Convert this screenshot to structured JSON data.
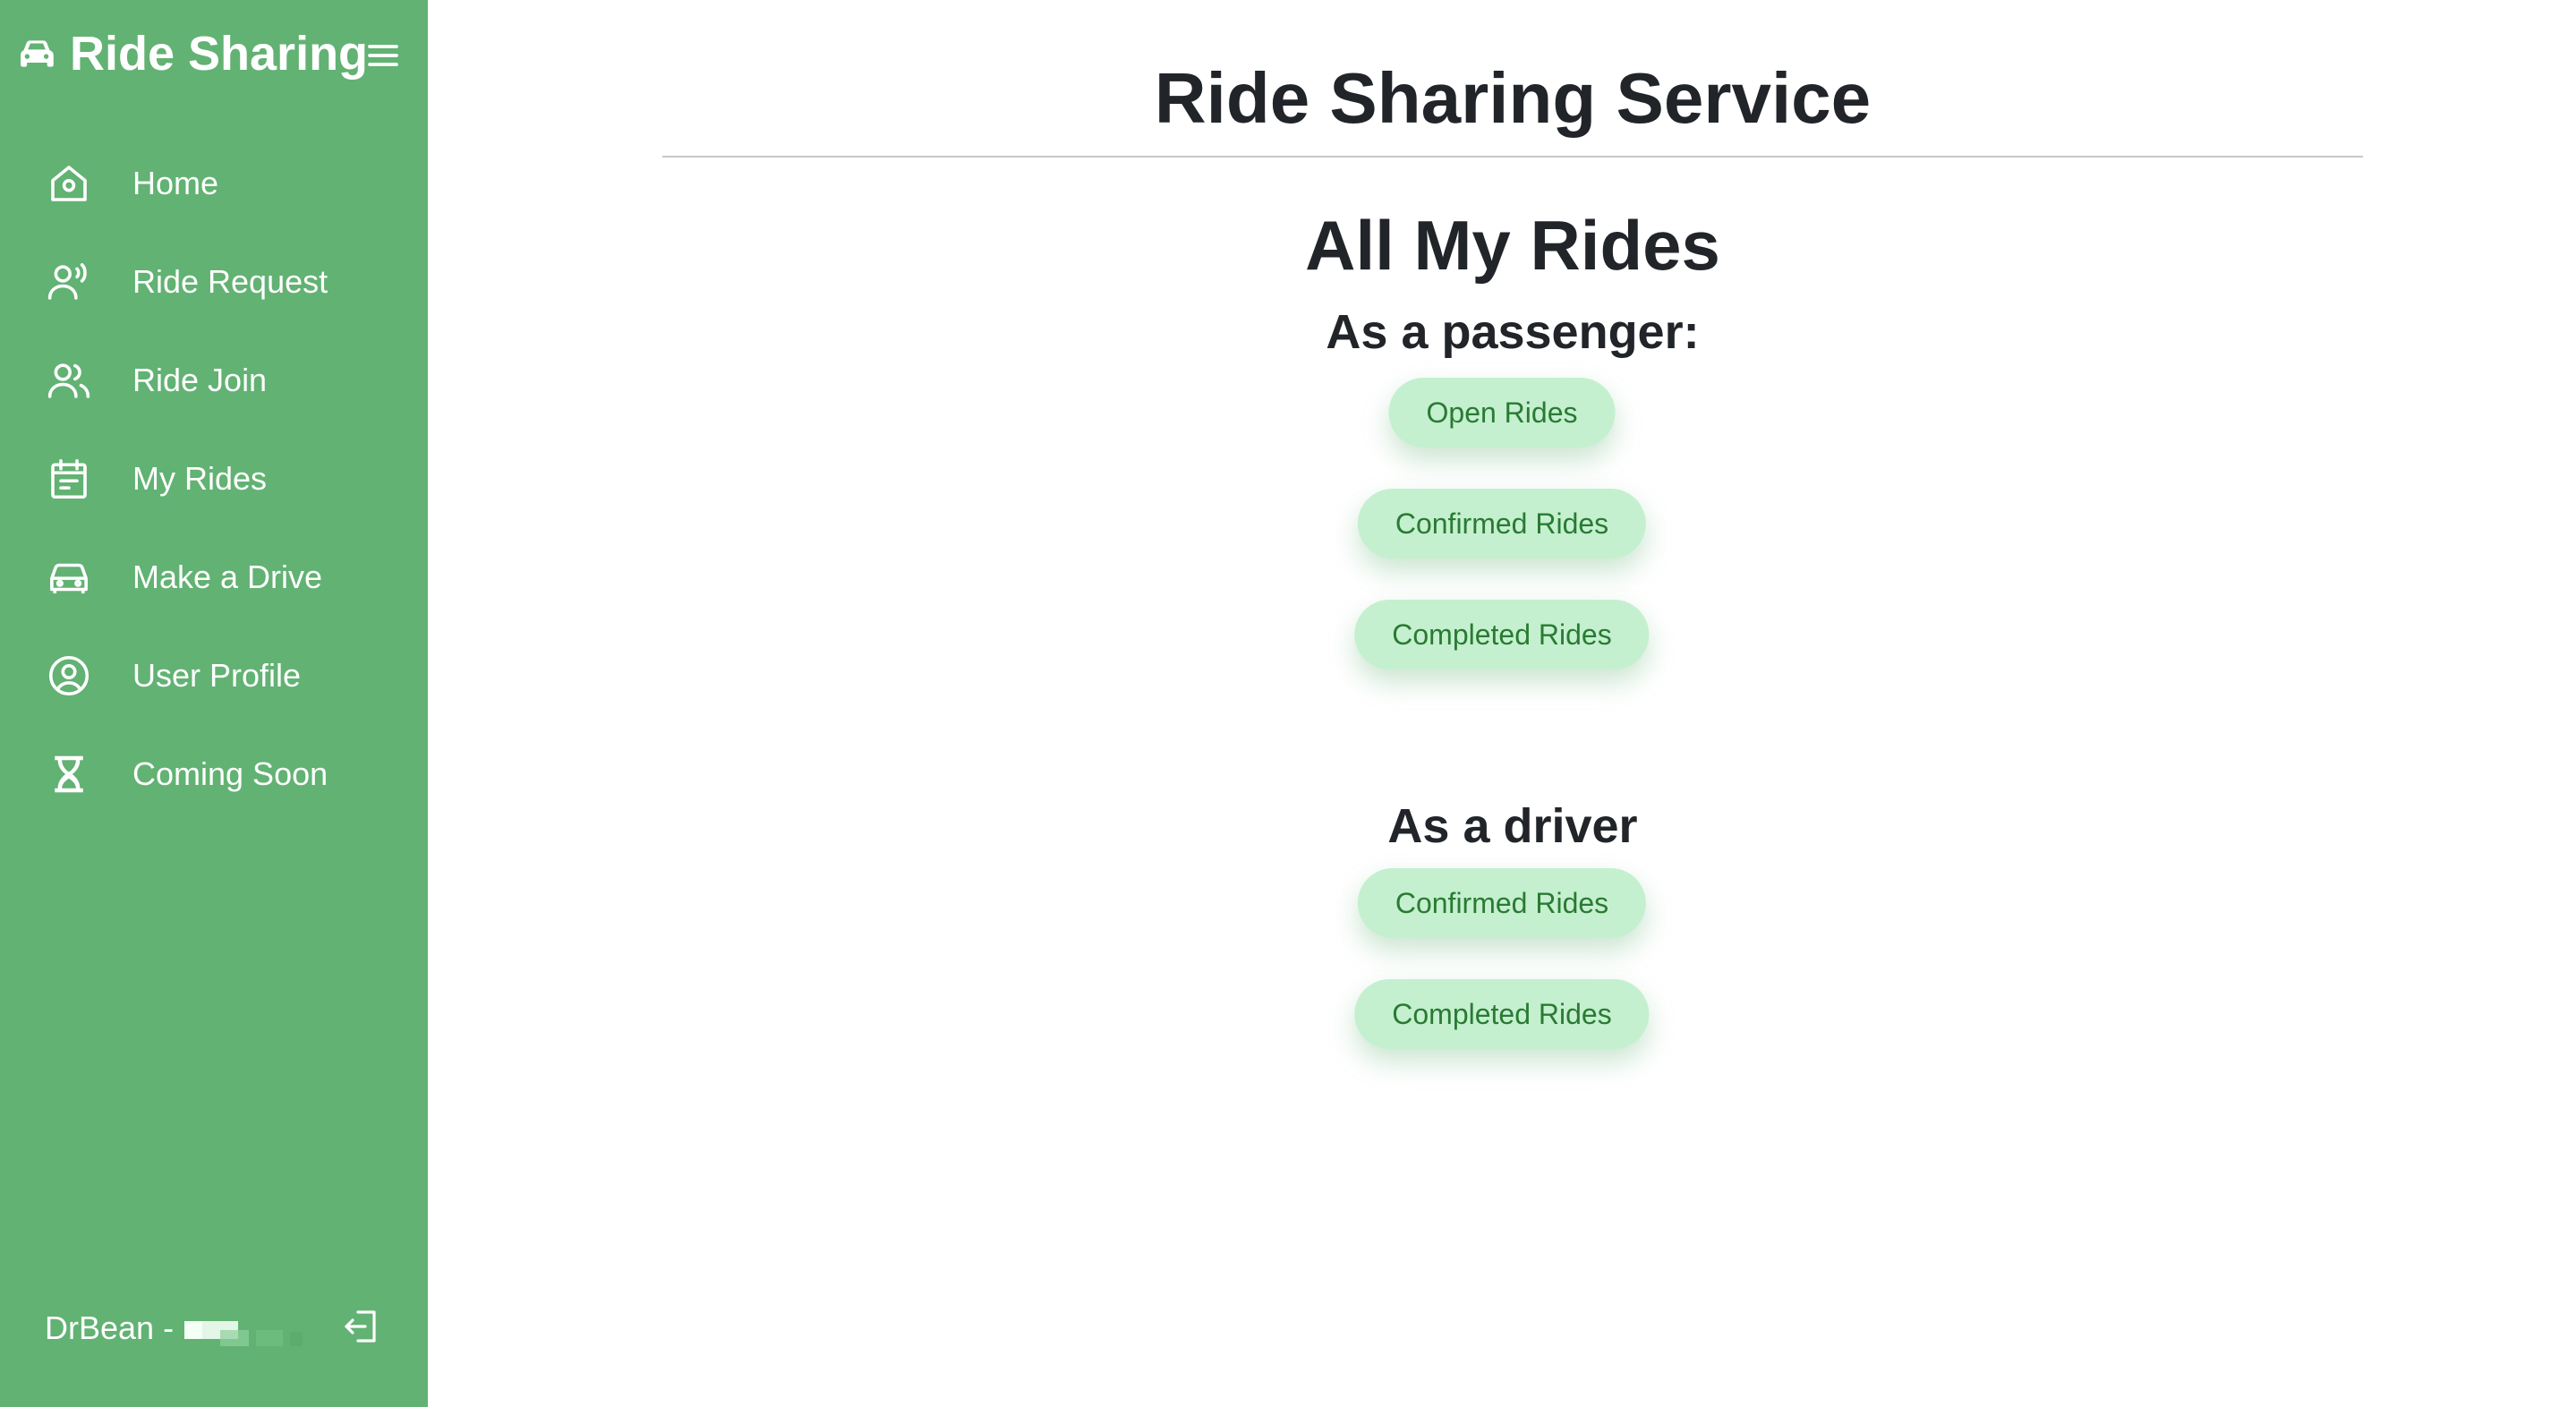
{
  "sidebar": {
    "brand": {
      "title": "Ride Sharing",
      "icon": "car-icon"
    },
    "toggle_icon": "hamburger-menu-icon",
    "items": [
      {
        "label": "Home",
        "icon": "home-icon"
      },
      {
        "label": "Ride Request",
        "icon": "person-voice-icon"
      },
      {
        "label": "Ride Join",
        "icon": "people-icon"
      },
      {
        "label": "My Rides",
        "icon": "calendar-icon"
      },
      {
        "label": "Make a Drive",
        "icon": "car-icon"
      },
      {
        "label": "User Profile",
        "icon": "user-circle-icon"
      },
      {
        "label": "Coming Soon",
        "icon": "hourglass-icon"
      }
    ],
    "user": {
      "name": "DrBean -",
      "logout_icon": "logout-icon"
    }
  },
  "main": {
    "title": "Ride Sharing Service",
    "heading": "All My Rides",
    "passenger": {
      "heading": "As a passenger:",
      "buttons": [
        "Open Rides",
        "Confirmed Rides",
        "Completed Rides"
      ]
    },
    "driver": {
      "heading": "As a driver",
      "buttons": [
        "Confirmed Rides",
        "Completed Rides"
      ]
    }
  },
  "colors": {
    "sidebar_bg": "#62b273",
    "pill_bg": "#c4f0cf",
    "pill_text": "#2a7a33",
    "heading_text": "#212529"
  }
}
